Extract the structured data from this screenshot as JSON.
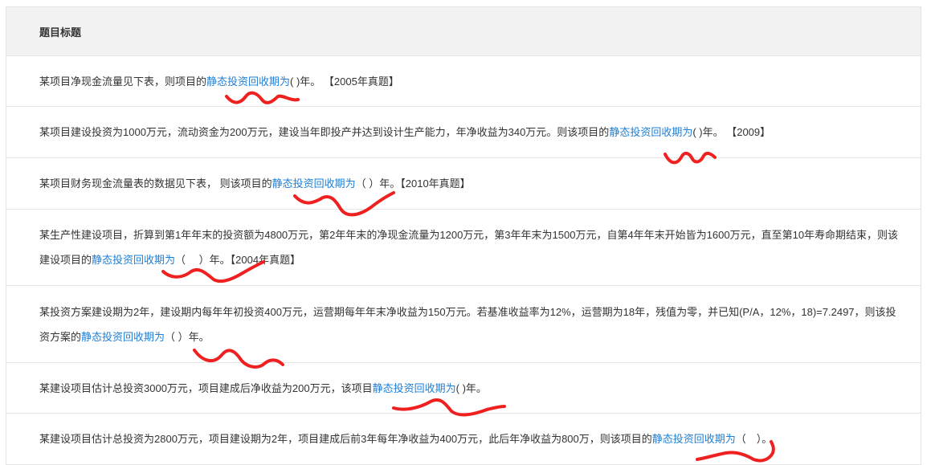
{
  "header": {
    "title": "题目标题"
  },
  "rows": [
    {
      "before": "某项目净现金流量见下表，则项目的",
      "highlight": "静态投资回收期为",
      "after": "( )年。 【2005年真题】"
    },
    {
      "before": "某项目建设投资为1000万元，流动资金为200万元，建设当年即投产并达到设计生产能力，年净收益为340万元。则该项目的",
      "highlight": "静态投资回收期为",
      "after": "( )年。 【2009】"
    },
    {
      "before": "某项目财务现金流量表的数据见下表， 则该项目的",
      "highlight": "静态投资回收期为",
      "after": "（ ）年。【2010年真题】"
    },
    {
      "before": "某生产性建设项目，折算到第1年年末的投资额为4800万元，第2年年末的净现金流量为1200万元，第3年年末为1500万元，自第4年年末开始皆为1600万元，直至第10年寿命期结束，则该建设项目的",
      "highlight": "静态投资回收期为",
      "after": "（　 ）年。【2004年真题】"
    },
    {
      "before": "某投资方案建设期为2年，建设期内每年年初投资400万元，运营期每年年末净收益为150万元。若基准收益率为12%，运营期为18年，残值为零，并已知(P/A，12%，18)=7.2497，则该投资方案的",
      "highlight": "静态投资回收期为",
      "after": "（ ）年。"
    },
    {
      "before": "某建设项目估计总投资3000万元，项目建成后净收益为200万元，该项目",
      "highlight": "静态投资回收期为",
      "after": "( )年。"
    },
    {
      "before": "某建设项目估计总投资为2800万元，项目建设期为2年，项目建成后前3年每年净收益为400万元，此后年净收益为800万，则该项目的",
      "highlight": "静态投资回收期为",
      "after": "（　）。"
    }
  ],
  "colors": {
    "link": "#1e7fd6",
    "annotation": "#ee2020",
    "header_bg": "#f2f2f2",
    "border": "#e6e6e6"
  }
}
